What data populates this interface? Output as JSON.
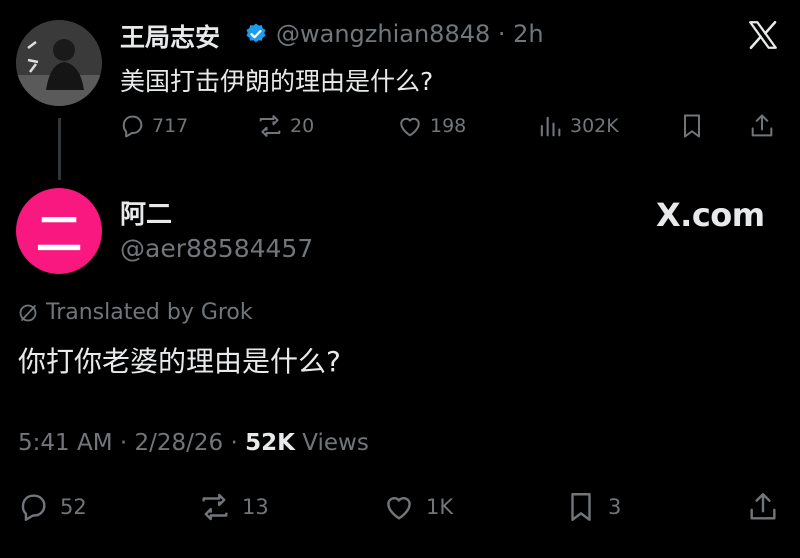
{
  "tweet1": {
    "name": "王局志安",
    "handle_line": "@wangzhian8848 · 2h",
    "text": "美国打击伊朗的理由是什么?",
    "replies": "717",
    "reposts": "20",
    "likes": "198",
    "views": "302K"
  },
  "tweet2": {
    "avatar_glyph": "二",
    "name": "阿二",
    "handle": "@aer88584457",
    "brand": "X.com",
    "translated_label": "Translated by Grok",
    "text": "你打你老婆的理由是什么?",
    "meta_time": "5:41 AM · 2/28/26 · ",
    "meta_views_num": "52K",
    "meta_views_label": " Views",
    "replies": "52",
    "reposts": "13",
    "likes": "1K",
    "bookmarks": "3"
  },
  "colors": {
    "background": "#000000",
    "text": "#e7e9ea",
    "muted": "#71767b",
    "verified": "#1d9bf0",
    "avatar2_bg": "#f9187f"
  }
}
